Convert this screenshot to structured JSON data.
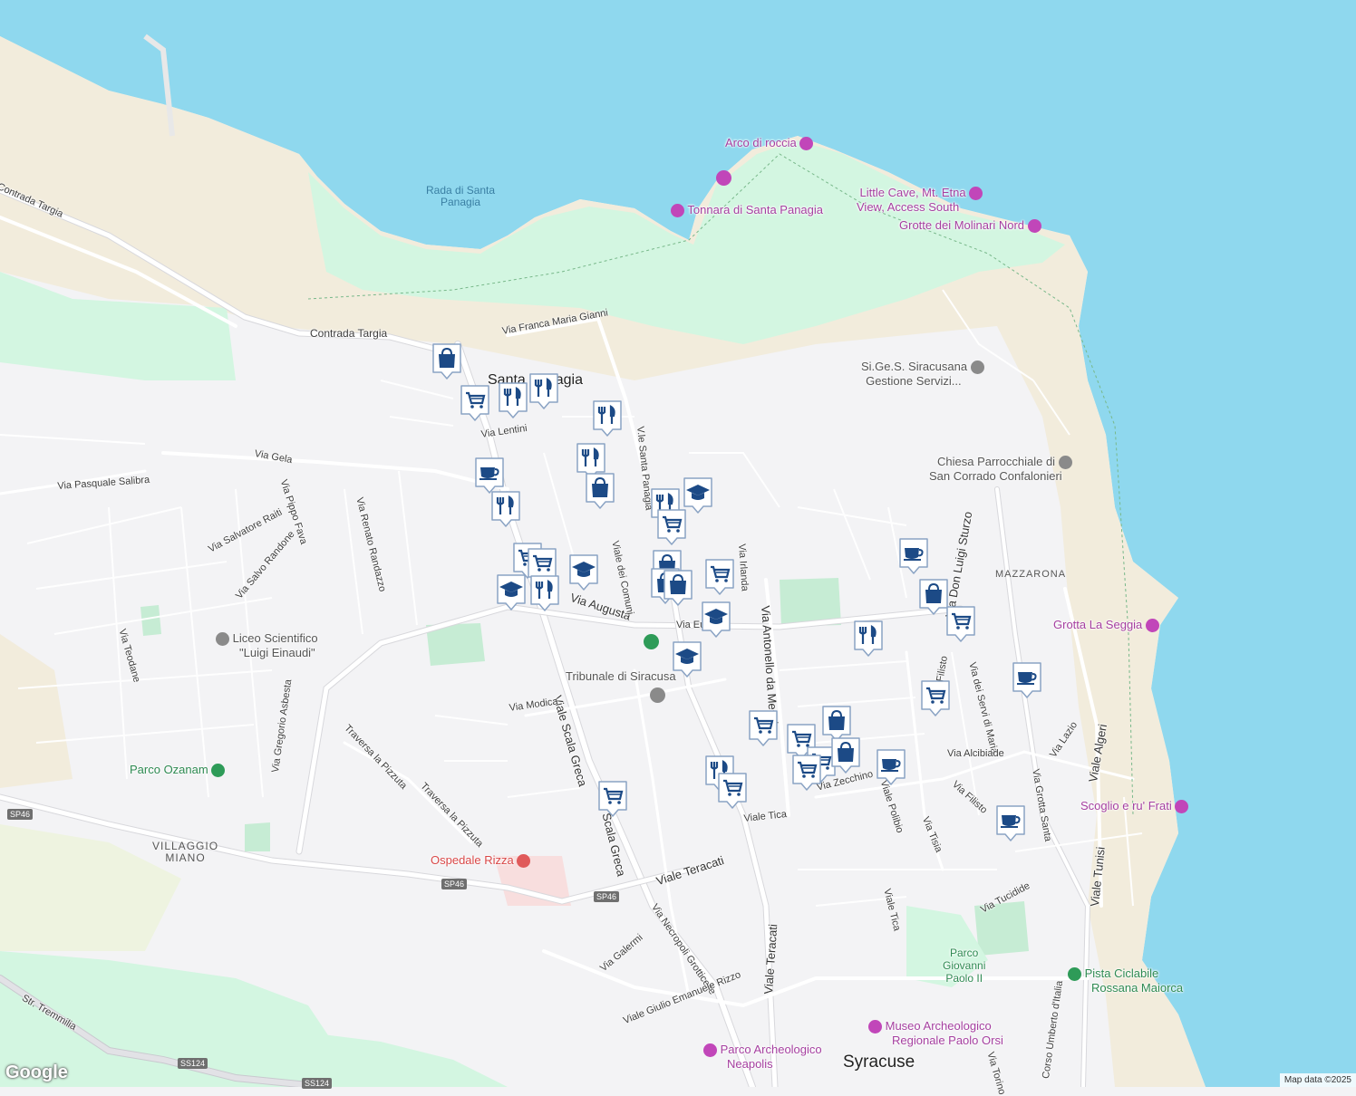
{
  "colors": {
    "sea": "#8fd8ee",
    "land": "#f3f3f5",
    "sand": "#f2ecdc",
    "park": "#d3f6e1",
    "road": "#ffffff",
    "marker": "#1c4a86"
  },
  "water_labels": [
    {
      "text1": "Rada di Santa",
      "text2": "Panagia"
    }
  ],
  "poi_labels": [
    {
      "text": "Arco di roccia",
      "icon": "camera-icon"
    },
    {
      "text": "Tonnara di Santa Panagia",
      "icon": "camera-icon"
    },
    {
      "text": "Little Cave, Mt. Etna",
      "text2": "View, Access South",
      "icon": "camera-icon"
    },
    {
      "text": "Grotte dei Molinari Nord",
      "icon": "camera-icon"
    },
    {
      "text": "Si.Ge.S. Siracusana",
      "text2": "Gestione Servizi...",
      "icon": "service-icon"
    },
    {
      "text": "Chiesa Parrocchiale di",
      "text2": "San Corrado Confalonieri",
      "icon": "church-icon"
    },
    {
      "text": "Grotta La Seggia",
      "icon": "camera-icon"
    },
    {
      "text": "Scoglio e ru' Frati",
      "icon": "camera-icon"
    },
    {
      "text": "Liceo Scientifico",
      "text2": "\"Luigi Einaudi\"",
      "icon": "school-icon"
    },
    {
      "text": "Tribunale di Siracusa",
      "icon": "courthouse-icon"
    },
    {
      "text": "Parco Ozanam",
      "icon": "tree-icon"
    },
    {
      "text": "Ospedale Rizza",
      "icon": "hospital-icon"
    },
    {
      "text": "Museo Archeologico",
      "text2": "Regionale Paolo Orsi",
      "icon": "museum-icon"
    },
    {
      "text": "Parco Archeologico",
      "text2": "Neapolis",
      "icon": "museum-icon"
    },
    {
      "text": "Pista Ciclabile",
      "text2": "Rossana Maiorca",
      "icon": "park-icon"
    },
    {
      "text": "Parco",
      "text2": "Giovanni",
      "text3": "Paolo II",
      "icon": ""
    }
  ],
  "road_labels": [
    "Contrada Targia",
    "Contrada Targia",
    "Via Franca Maria Gianni",
    "Via Lentini",
    "Via Gela",
    "Via Pasquale Salibra",
    "Via Salvatore Raiti",
    "Via Pippo Fava",
    "Via Salvo Randone",
    "Via Renato Randazzo",
    "Via Teodane",
    "Via Gregorio Asbesta",
    "Viale Scala Greca",
    "Via Augusta",
    "Via Modica",
    "Traversa la Pizzuta",
    "Traversa la Pizzuta",
    "Viale Teracati",
    "Via Necropoli Grotticelle",
    "Via Galermi",
    "Viale Giulio Emanuele Rizzo",
    "Viale Teracati",
    "Via Antonello da Messina",
    "Via Irlanda",
    "Viale dei Comuni",
    "V.le Santa Panagia",
    "Via Don Luigi Sturzo",
    "Via dei Servi di Maria",
    "Via Alcibiade",
    "Via Filisto",
    "Via Tisia",
    "Viale Polibio",
    "Viale Tica",
    "Viale Tica",
    "Via Zecchino",
    "Via Tucidide",
    "Via Grotta Santa",
    "Via Lazio",
    "Viale Algeri",
    "Viale Tunisi",
    "Str. Tremmilia",
    "Via Europa",
    "Via Filisto",
    "Via Torino",
    "Corso Umberto d'Italia",
    "Scala Greca"
  ],
  "area_labels": [
    {
      "text1": "VILLAGGIO",
      "text2": "MIANO"
    },
    {
      "text1": "MAZZARONA",
      "text2": ""
    }
  ],
  "place_labels": {
    "santa_panagia": "Santa Panagia",
    "city": "Syracuse"
  },
  "shields": [
    "SP46",
    "SP46",
    "SP46",
    "SS124",
    "SS124"
  ],
  "markers": [
    "shopping-bag-icon",
    "cart-icon",
    "restaurant-icon",
    "restaurant-icon",
    "restaurant-icon",
    "cafe-icon",
    "restaurant-icon",
    "restaurant-icon",
    "shopping-bag-icon",
    "restaurant-icon",
    "education-icon",
    "cart-icon",
    "cart-icon",
    "cart-icon",
    "education-icon",
    "restaurant-icon",
    "education-icon",
    "shopping-bag-icon",
    "cart-icon",
    "shopping-bag-icon",
    "shopping-bag-icon",
    "education-icon",
    "education-icon",
    "cart-icon",
    "cart-icon",
    "shopping-bag-icon",
    "cart-icon",
    "shopping-bag-icon",
    "restaurant-icon",
    "cart-icon",
    "cart-icon",
    "cart-icon",
    "cafe-icon",
    "cafe-icon",
    "cafe-icon",
    "shopping-bag-icon",
    "cart-icon",
    "restaurant-icon",
    "cart-icon",
    "cafe-icon"
  ],
  "attribution": "Map data ©2025",
  "logo": "Google"
}
